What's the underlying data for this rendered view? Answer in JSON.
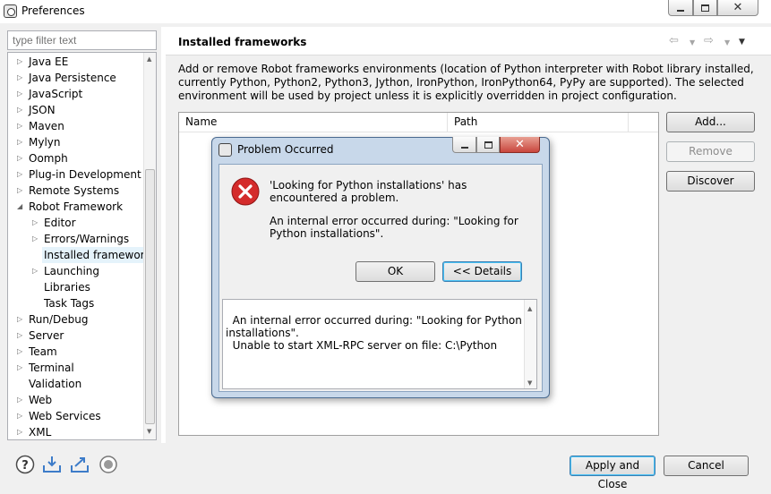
{
  "window": {
    "title": "Preferences"
  },
  "filter": {
    "placeholder": "type filter text"
  },
  "tree": [
    {
      "label": "Java EE",
      "level": 0,
      "arrow": true
    },
    {
      "label": "Java Persistence",
      "level": 0,
      "arrow": true
    },
    {
      "label": "JavaScript",
      "level": 0,
      "arrow": true
    },
    {
      "label": "JSON",
      "level": 0,
      "arrow": true
    },
    {
      "label": "Maven",
      "level": 0,
      "arrow": true
    },
    {
      "label": "Mylyn",
      "level": 0,
      "arrow": true
    },
    {
      "label": "Oomph",
      "level": 0,
      "arrow": true
    },
    {
      "label": "Plug-in Development",
      "level": 0,
      "arrow": true
    },
    {
      "label": "Remote Systems",
      "level": 0,
      "arrow": true
    },
    {
      "label": "Robot Framework",
      "level": 0,
      "arrow": true,
      "expanded": true
    },
    {
      "label": "Editor",
      "level": 1,
      "arrow": true
    },
    {
      "label": "Errors/Warnings",
      "level": 1,
      "arrow": true
    },
    {
      "label": "Installed frameworks",
      "level": 1,
      "arrow": false,
      "selected": true
    },
    {
      "label": "Launching",
      "level": 1,
      "arrow": true
    },
    {
      "label": "Libraries",
      "level": 1,
      "arrow": false
    },
    {
      "label": "Task Tags",
      "level": 1,
      "arrow": false
    },
    {
      "label": "Run/Debug",
      "level": 0,
      "arrow": true
    },
    {
      "label": "Server",
      "level": 0,
      "arrow": true
    },
    {
      "label": "Team",
      "level": 0,
      "arrow": true
    },
    {
      "label": "Terminal",
      "level": 0,
      "arrow": true
    },
    {
      "label": "Validation",
      "level": 0,
      "arrow": false
    },
    {
      "label": "Web",
      "level": 0,
      "arrow": true
    },
    {
      "label": "Web Services",
      "level": 0,
      "arrow": true
    },
    {
      "label": "XML",
      "level": 0,
      "arrow": true
    }
  ],
  "page": {
    "title": "Installed frameworks",
    "description": "Add or remove Robot frameworks environments (location of Python interpreter with Robot library installed, currently Python, Python2, Python3, Jython, IronPython, IronPython64, PyPy are supported). The selected environment will be used by project unless it is explicitly overridden in project configuration.",
    "columns": [
      "Name",
      "Path"
    ],
    "buttons": {
      "add": "Add...",
      "remove": "Remove",
      "discover": "Discover"
    }
  },
  "footer": {
    "apply_close": "Apply and Close",
    "cancel": "Cancel"
  },
  "dialog": {
    "title": "Problem Occurred",
    "message": "'Looking for Python installations' has encountered a problem.",
    "submessage": "An internal error occurred during: \"Looking for Python installations\".",
    "ok": "OK",
    "details_button": "<< Details",
    "details_text": "An internal error occurred during: \"Looking for Python\ninstallations\".\n  Unable to start XML-RPC server on file: C:\\Python"
  },
  "colors": {
    "error_red": "#d42b2b",
    "dialog_frame": "#c8d8ea",
    "close_button": "#c9463d",
    "selection": "#e5f3fb"
  }
}
